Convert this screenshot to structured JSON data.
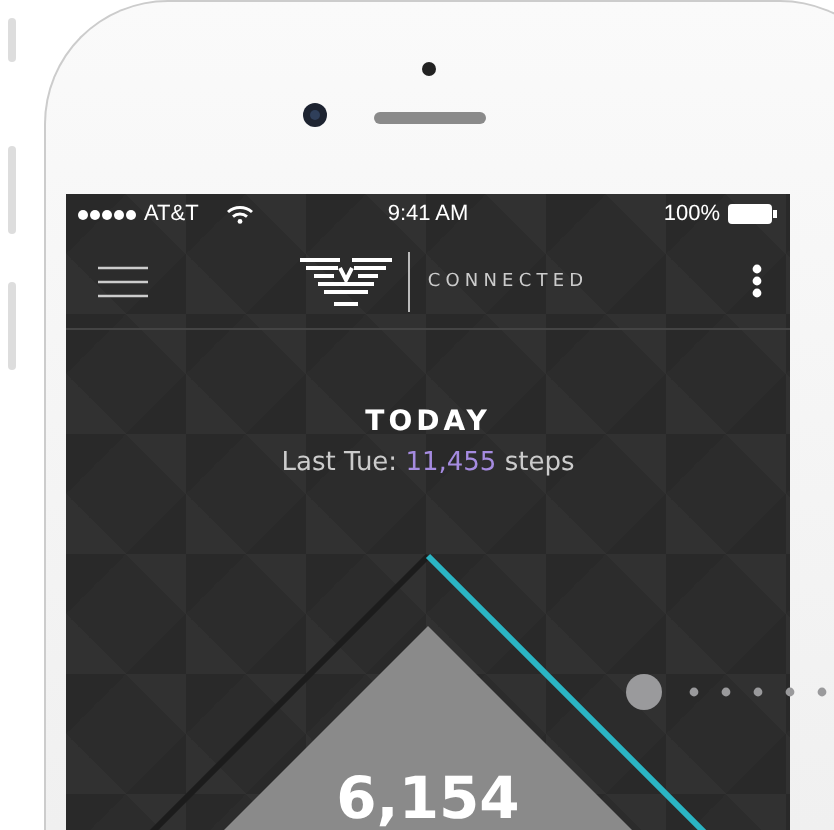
{
  "status_bar": {
    "carrier": "AT&T",
    "time": "9:41 AM",
    "battery": "100%"
  },
  "header": {
    "brand": "CONNECTED"
  },
  "today": {
    "title": "TODAY",
    "comparison_prefix": "Last Tue: ",
    "comparison_value": "11,455",
    "comparison_suffix": " steps",
    "steps": "6,154"
  },
  "page_indicator": [
    {
      "selected": true
    },
    {
      "selected": false
    },
    {
      "selected": false
    },
    {
      "selected": false
    },
    {
      "selected": false
    },
    {
      "selected": false
    }
  ]
}
